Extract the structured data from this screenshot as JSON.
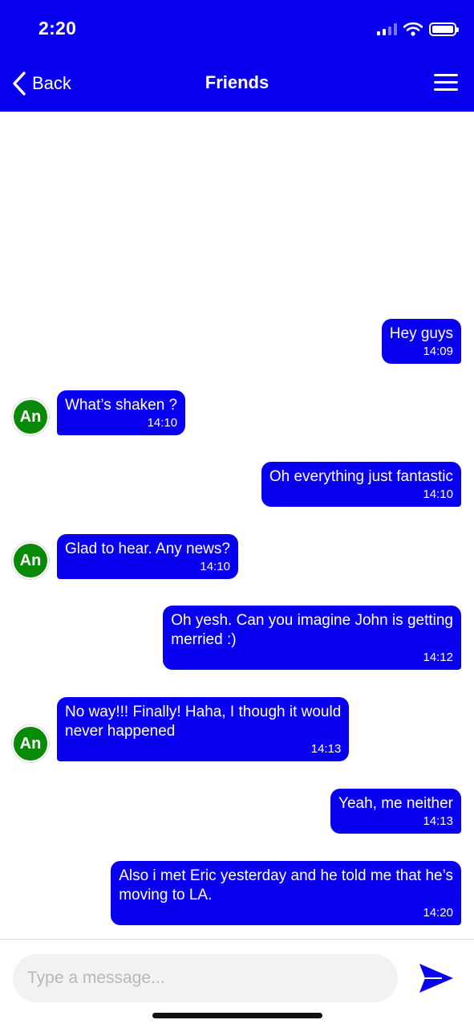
{
  "status_bar": {
    "time": "2:20"
  },
  "nav": {
    "back_label": "Back",
    "title": "Friends"
  },
  "messages": [
    {
      "direction": "out",
      "text": "Hey guys",
      "time": "14:09"
    },
    {
      "direction": "in",
      "avatar": "An",
      "text": "What’s shaken ?",
      "time": "14:10"
    },
    {
      "direction": "out",
      "text": "Oh everything just fantastic",
      "time": "14:10"
    },
    {
      "direction": "in",
      "avatar": "An",
      "text": "Glad to hear. Any news?",
      "time": "14:10"
    },
    {
      "direction": "out",
      "text": "Oh yesh. Can you imagine John is getting\nmerried :)",
      "time": "14:12"
    },
    {
      "direction": "in",
      "avatar": "An",
      "text": "No way!!! Finally! Haha, I though it would\nnever happened",
      "time": "14:13"
    },
    {
      "direction": "out",
      "text": "Yeah, me neither",
      "time": "14:13"
    },
    {
      "direction": "out",
      "text": "Also i met Eric yesterday and he told me that he’s\nmoving to LA.",
      "time": "14:20"
    }
  ],
  "composer": {
    "placeholder": "Type a message...",
    "value": ""
  },
  "icons": {
    "back": "chevron-left-icon",
    "menu": "hamburger-menu-icon",
    "send": "send-arrow-icon",
    "signal": "cellular-signal-icon",
    "wifi": "wifi-icon",
    "battery": "battery-icon"
  },
  "colors": {
    "header_bg": "#0a00f0",
    "bubble_bg": "#0a00f0",
    "avatar_bg": "#098a09",
    "input_bg": "#f2f2f2"
  }
}
